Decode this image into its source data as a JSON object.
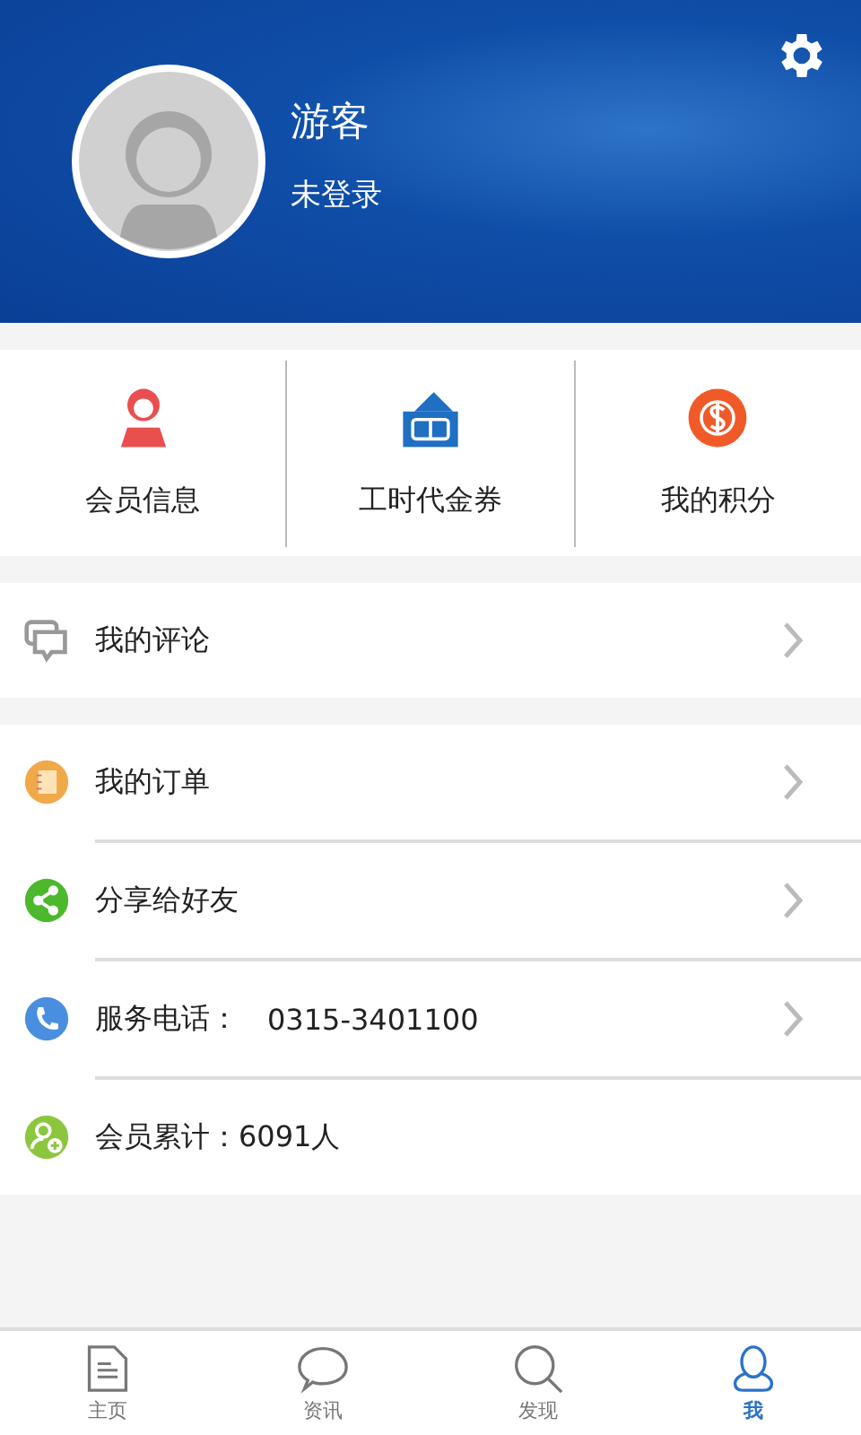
{
  "profile": {
    "name": "游客",
    "status": "未登录"
  },
  "quick_actions": [
    {
      "kind": "member",
      "label": "会员信息"
    },
    {
      "kind": "coupon",
      "label": "工时代金券"
    },
    {
      "kind": "points",
      "label": "我的积分"
    }
  ],
  "menu_groups": [
    {
      "items": [
        {
          "kind": "comment",
          "label": "我的评论",
          "arrow": true
        }
      ]
    },
    {
      "items": [
        {
          "kind": "order",
          "label": "我的订单",
          "arrow": true
        },
        {
          "kind": "share",
          "label": "分享给好友",
          "arrow": true
        },
        {
          "kind": "phone",
          "label": "服务电话：",
          "value": "0315-3401100",
          "arrow": true
        },
        {
          "kind": "members",
          "label": "会员累计：6091人",
          "arrow": false
        }
      ]
    }
  ],
  "tabs": [
    {
      "kind": "home",
      "label": "主页",
      "selected": false
    },
    {
      "kind": "news",
      "label": "资讯",
      "selected": false
    },
    {
      "kind": "discover",
      "label": "发现",
      "selected": false
    },
    {
      "kind": "me",
      "label": "我",
      "selected": true
    }
  ]
}
